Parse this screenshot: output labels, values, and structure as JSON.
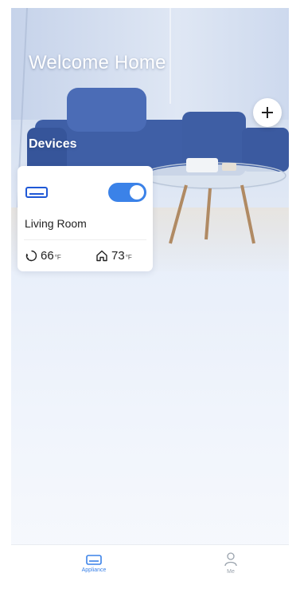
{
  "header": {
    "title": "Welcome Home",
    "add_icon": "plus-icon"
  },
  "devices": {
    "section_label": "Devices",
    "items": [
      {
        "icon": "air-conditioner-icon",
        "power_on": true,
        "room": "Living Room",
        "indoor_temp_value": "66",
        "indoor_temp_unit": "°F",
        "target_temp_value": "73",
        "target_temp_unit": "°F"
      }
    ]
  },
  "tabbar": {
    "tabs": [
      {
        "label": "Appliance",
        "icon": "appliance-icon",
        "active": true
      },
      {
        "label": "Me",
        "icon": "person-icon",
        "active": false
      }
    ]
  },
  "colors": {
    "accent": "#3b82e8",
    "inactive": "#9aa3ad"
  }
}
